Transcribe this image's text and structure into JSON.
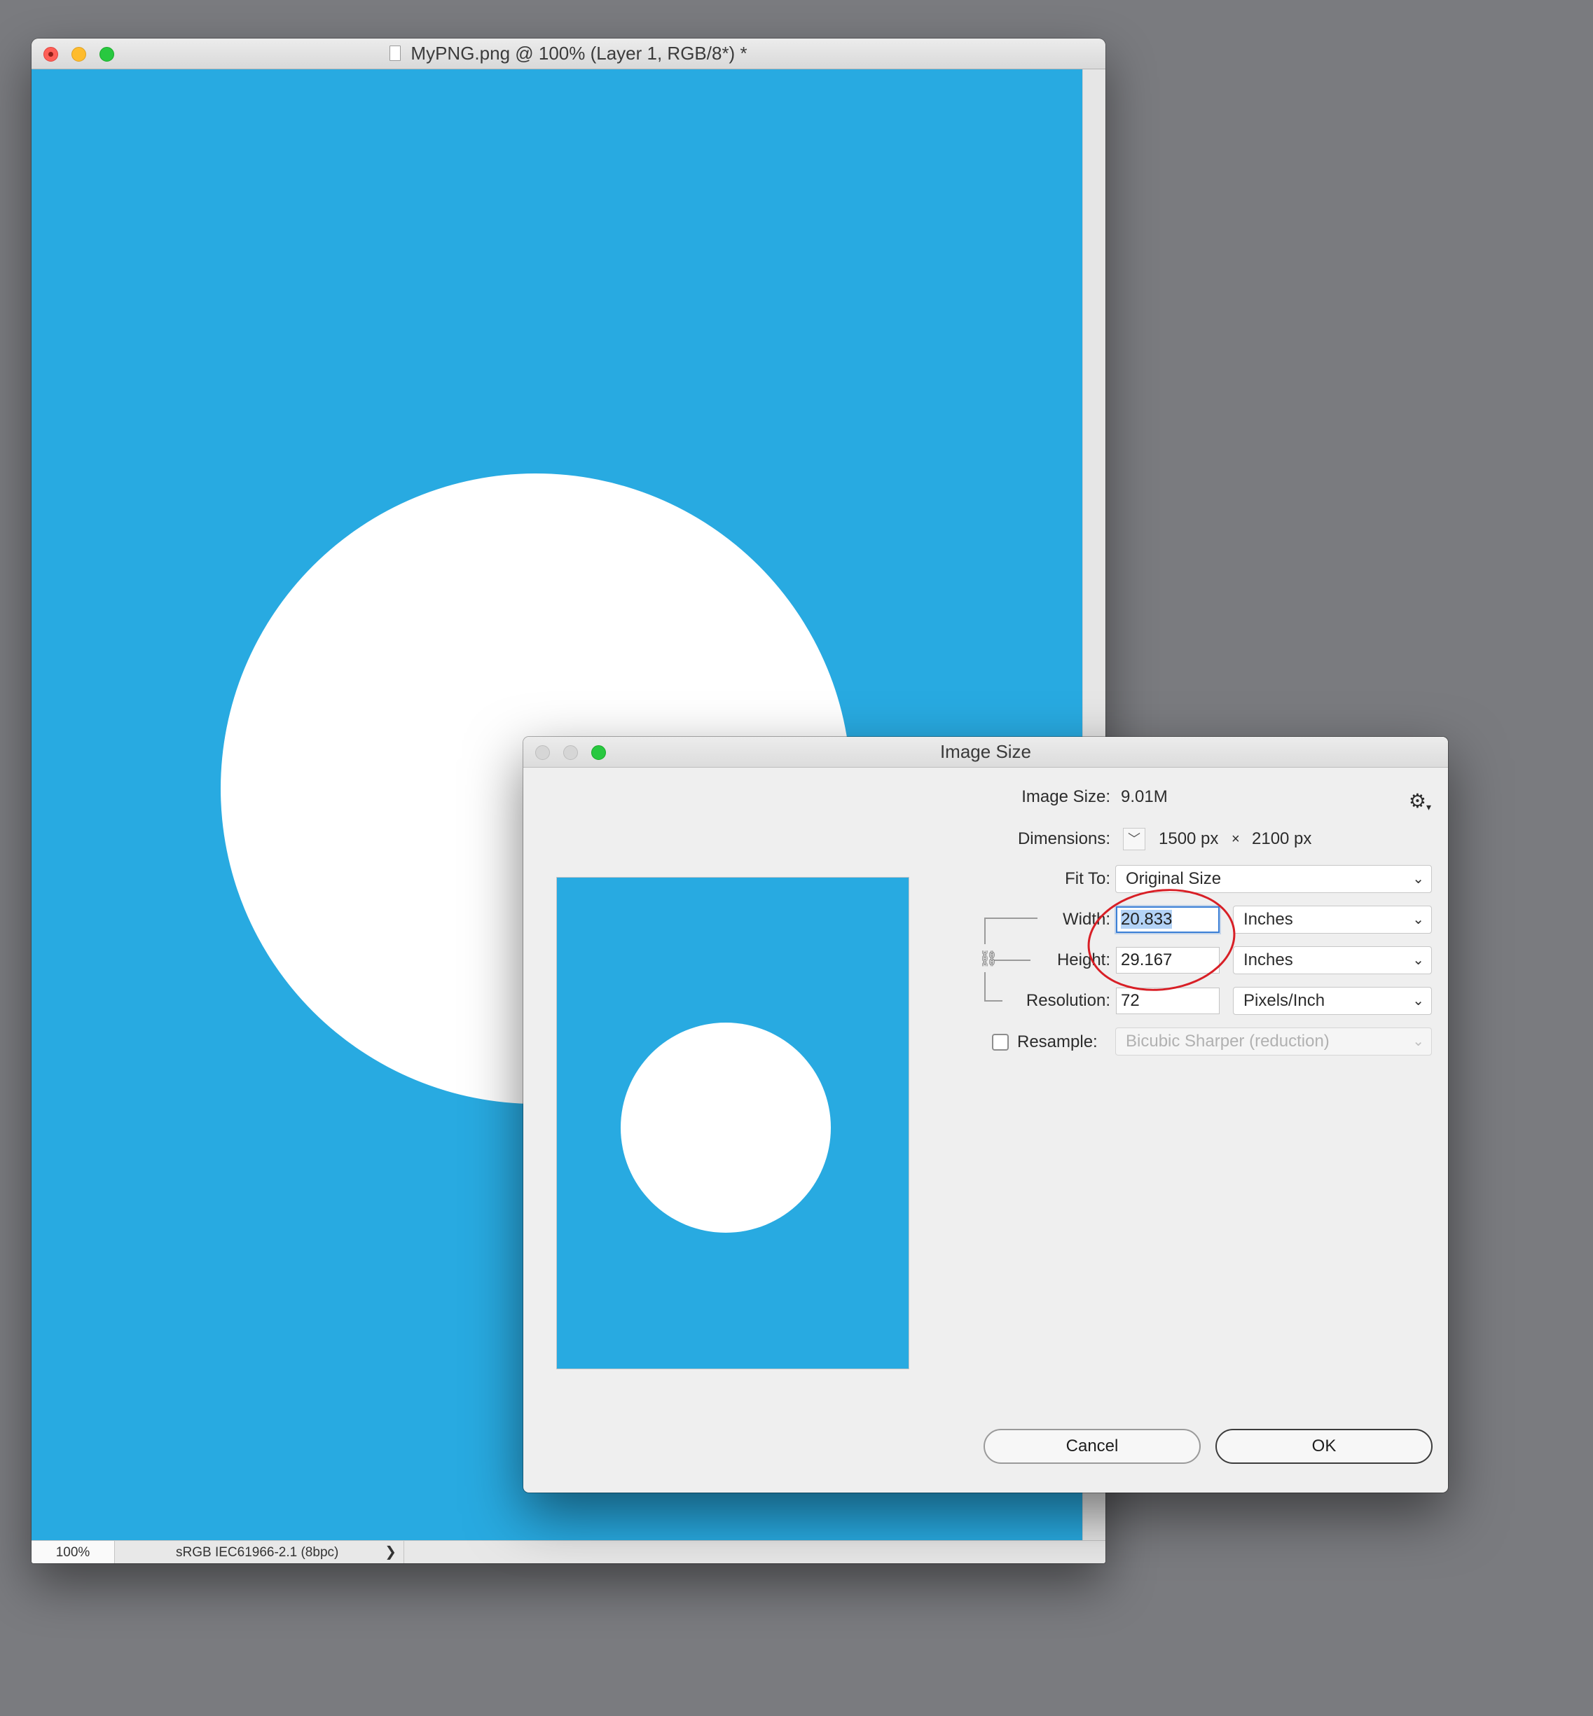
{
  "document_window": {
    "title": "MyPNG.png @ 100% (Layer 1, RGB/8*) *",
    "file_icon": "file-icon",
    "canvas_color": "#28aae1",
    "shape_color": "#ffffff",
    "status": {
      "zoom": "100%",
      "profile": "sRGB IEC61966-2.1 (8bpc)",
      "arrow": "❯"
    }
  },
  "dialog": {
    "title": "Image Size",
    "gear_icon": "⚙",
    "gear_caret": "▾",
    "image_size": {
      "label": "Image Size:",
      "value": "9.01M"
    },
    "dimensions": {
      "label": "Dimensions:",
      "toggle_glyph": "﹀",
      "width": "1500 px",
      "times": "×",
      "height": "2100 px"
    },
    "fit_to": {
      "label": "Fit To:",
      "value": "Original Size"
    },
    "width": {
      "label": "Width:",
      "value": "20.833",
      "unit": "Inches"
    },
    "height": {
      "label": "Height:",
      "value": "29.167",
      "unit": "Inches"
    },
    "resolution": {
      "label": "Resolution:",
      "value": "72",
      "unit": "Pixels/Inch"
    },
    "resample": {
      "label": "Resample:",
      "checked": false,
      "method": "Bicubic Sharper (reduction)"
    },
    "link_icon": "⛓",
    "chevron": "⌄",
    "buttons": {
      "cancel": "Cancel",
      "ok": "OK"
    },
    "annotation_color": "#d81f26"
  }
}
